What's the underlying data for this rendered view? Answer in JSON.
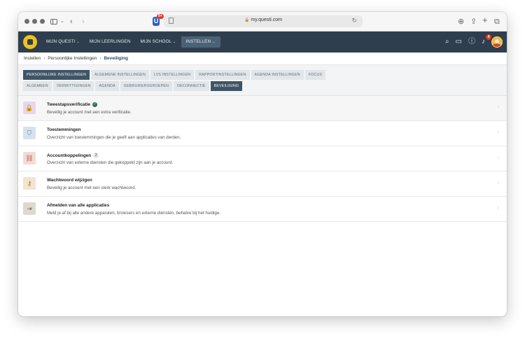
{
  "browser": {
    "url": "my.questi.com",
    "extension_badge": "9+"
  },
  "nav": {
    "items": [
      {
        "label": "MIJN QUESTI",
        "caret": true,
        "active": false
      },
      {
        "label": "MIJN LEERLINGEN",
        "caret": false,
        "active": false
      },
      {
        "label": "MIJN SCHOOL",
        "caret": true,
        "active": false
      },
      {
        "label": "INSTELLEN",
        "caret": true,
        "active": true
      }
    ],
    "notification_count": "4"
  },
  "breadcrumb": [
    "Instellen",
    "Persoonlijke Instellingen",
    "Beveiliging"
  ],
  "tabs": {
    "row1": [
      {
        "label": "PERSOONLIJKE INSTELLINGEN",
        "active": true
      },
      {
        "label": "ALGEMENE INSTELLINGEN",
        "active": false
      },
      {
        "label": "LVS INSTELLINGEN",
        "active": false
      },
      {
        "label": "RAPPORTINSTELLINGEN",
        "active": false
      },
      {
        "label": "AGENDA INSTELLINGEN",
        "active": false
      },
      {
        "label": "FOCUS",
        "active": false
      }
    ],
    "row2": [
      {
        "label": "ALGEMEEN",
        "active": false
      },
      {
        "label": "VERWITTIGINGEN",
        "active": false
      },
      {
        "label": "AGENDA",
        "active": false
      },
      {
        "label": "GEBRUIKERSGROEPEN",
        "active": false
      },
      {
        "label": "DECONNECTIE",
        "active": false
      },
      {
        "label": "BEVEILIGING",
        "active": true
      }
    ]
  },
  "settings": [
    {
      "name": "two-step",
      "title": "Tweestapsverificatie",
      "description": "Beveilig je account met een extra verificatie.",
      "icon": "lock-icon",
      "glyph": "🔒",
      "bg": "#e9d5ea",
      "fg": "#8a5a8c",
      "verified": true,
      "badge": ""
    },
    {
      "name": "permissions",
      "title": "Toestemmingen",
      "description": "Overzicht van toestemmingen die je geeft aan applicaties van derden.",
      "icon": "shield-icon",
      "glyph": "⛉",
      "bg": "#d6e2ee",
      "fg": "#5d7d9a",
      "verified": false,
      "badge": ""
    },
    {
      "name": "account-links",
      "title": "Accountkoppelingen",
      "description": "Overzicht van externe diensten die gekoppeld zijn aan je account.",
      "icon": "link-icon",
      "glyph": "⛓",
      "bg": "#f4d9d6",
      "fg": "#b5574b",
      "verified": false,
      "badge": "2"
    },
    {
      "name": "password",
      "title": "Wachtwoord wijzigen",
      "description": "Beveilig je account met een sterk wachtwoord.",
      "icon": "key-icon",
      "glyph": "⚷",
      "bg": "#f3e4cf",
      "fg": "#a07a3e",
      "verified": false,
      "badge": ""
    },
    {
      "name": "logout-all",
      "title": "Afmelden van alle applicaties",
      "description": "Meld je af bij alle andere apparaten, browsers en externe diensten, behalve bij het huidige.",
      "icon": "logout-icon",
      "glyph": "⇥",
      "bg": "#ddd9cf",
      "fg": "#6d6a5c",
      "verified": false,
      "badge": ""
    }
  ]
}
